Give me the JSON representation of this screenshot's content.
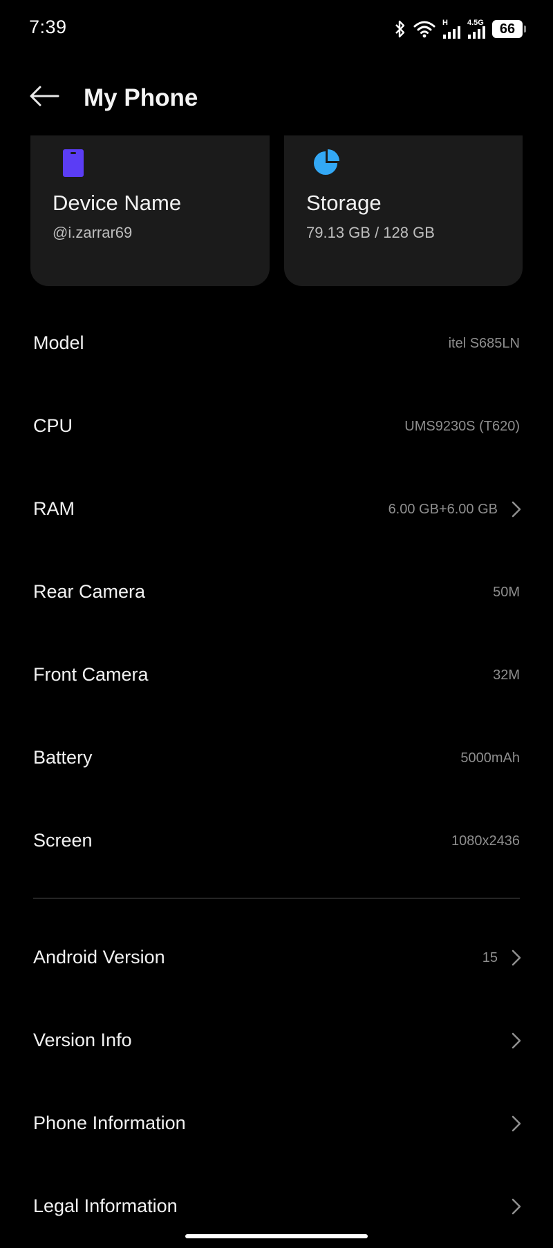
{
  "status_bar": {
    "time": "7:39",
    "network_h": "H",
    "network_4g": "4.5G",
    "battery": "66"
  },
  "header": {
    "title": "My Phone",
    "back_icon": "arrow-left-icon"
  },
  "cards": {
    "device": {
      "title": "Device Name",
      "value": "@i.zarrar69",
      "icon": "phone-icon",
      "icon_color": "#5b3df5"
    },
    "storage": {
      "title": "Storage",
      "value": "79.13 GB / 128 GB",
      "icon": "pie-chart-icon",
      "icon_color": "#33a8f5"
    }
  },
  "specs": [
    {
      "label": "Model",
      "value": "itel S685LN"
    },
    {
      "label": "CPU",
      "value": "UMS9230S (T620)"
    },
    {
      "label": "RAM",
      "value": "6.00 GB+6.00 GB"
    },
    {
      "label": "Rear Camera",
      "value": "50M"
    },
    {
      "label": "Front Camera",
      "value": "32M"
    },
    {
      "label": "Battery",
      "value": "5000mAh"
    },
    {
      "label": "Screen",
      "value": "1080x2436"
    }
  ],
  "more": [
    {
      "label": "Android Version",
      "value": "15"
    },
    {
      "label": "Version Info",
      "value": ""
    },
    {
      "label": "Phone Information",
      "value": ""
    },
    {
      "label": "Legal Information",
      "value": ""
    }
  ],
  "colors": {
    "background": "#000000",
    "card": "#1b1b1b",
    "secondary_text": "#8e8e8e"
  }
}
